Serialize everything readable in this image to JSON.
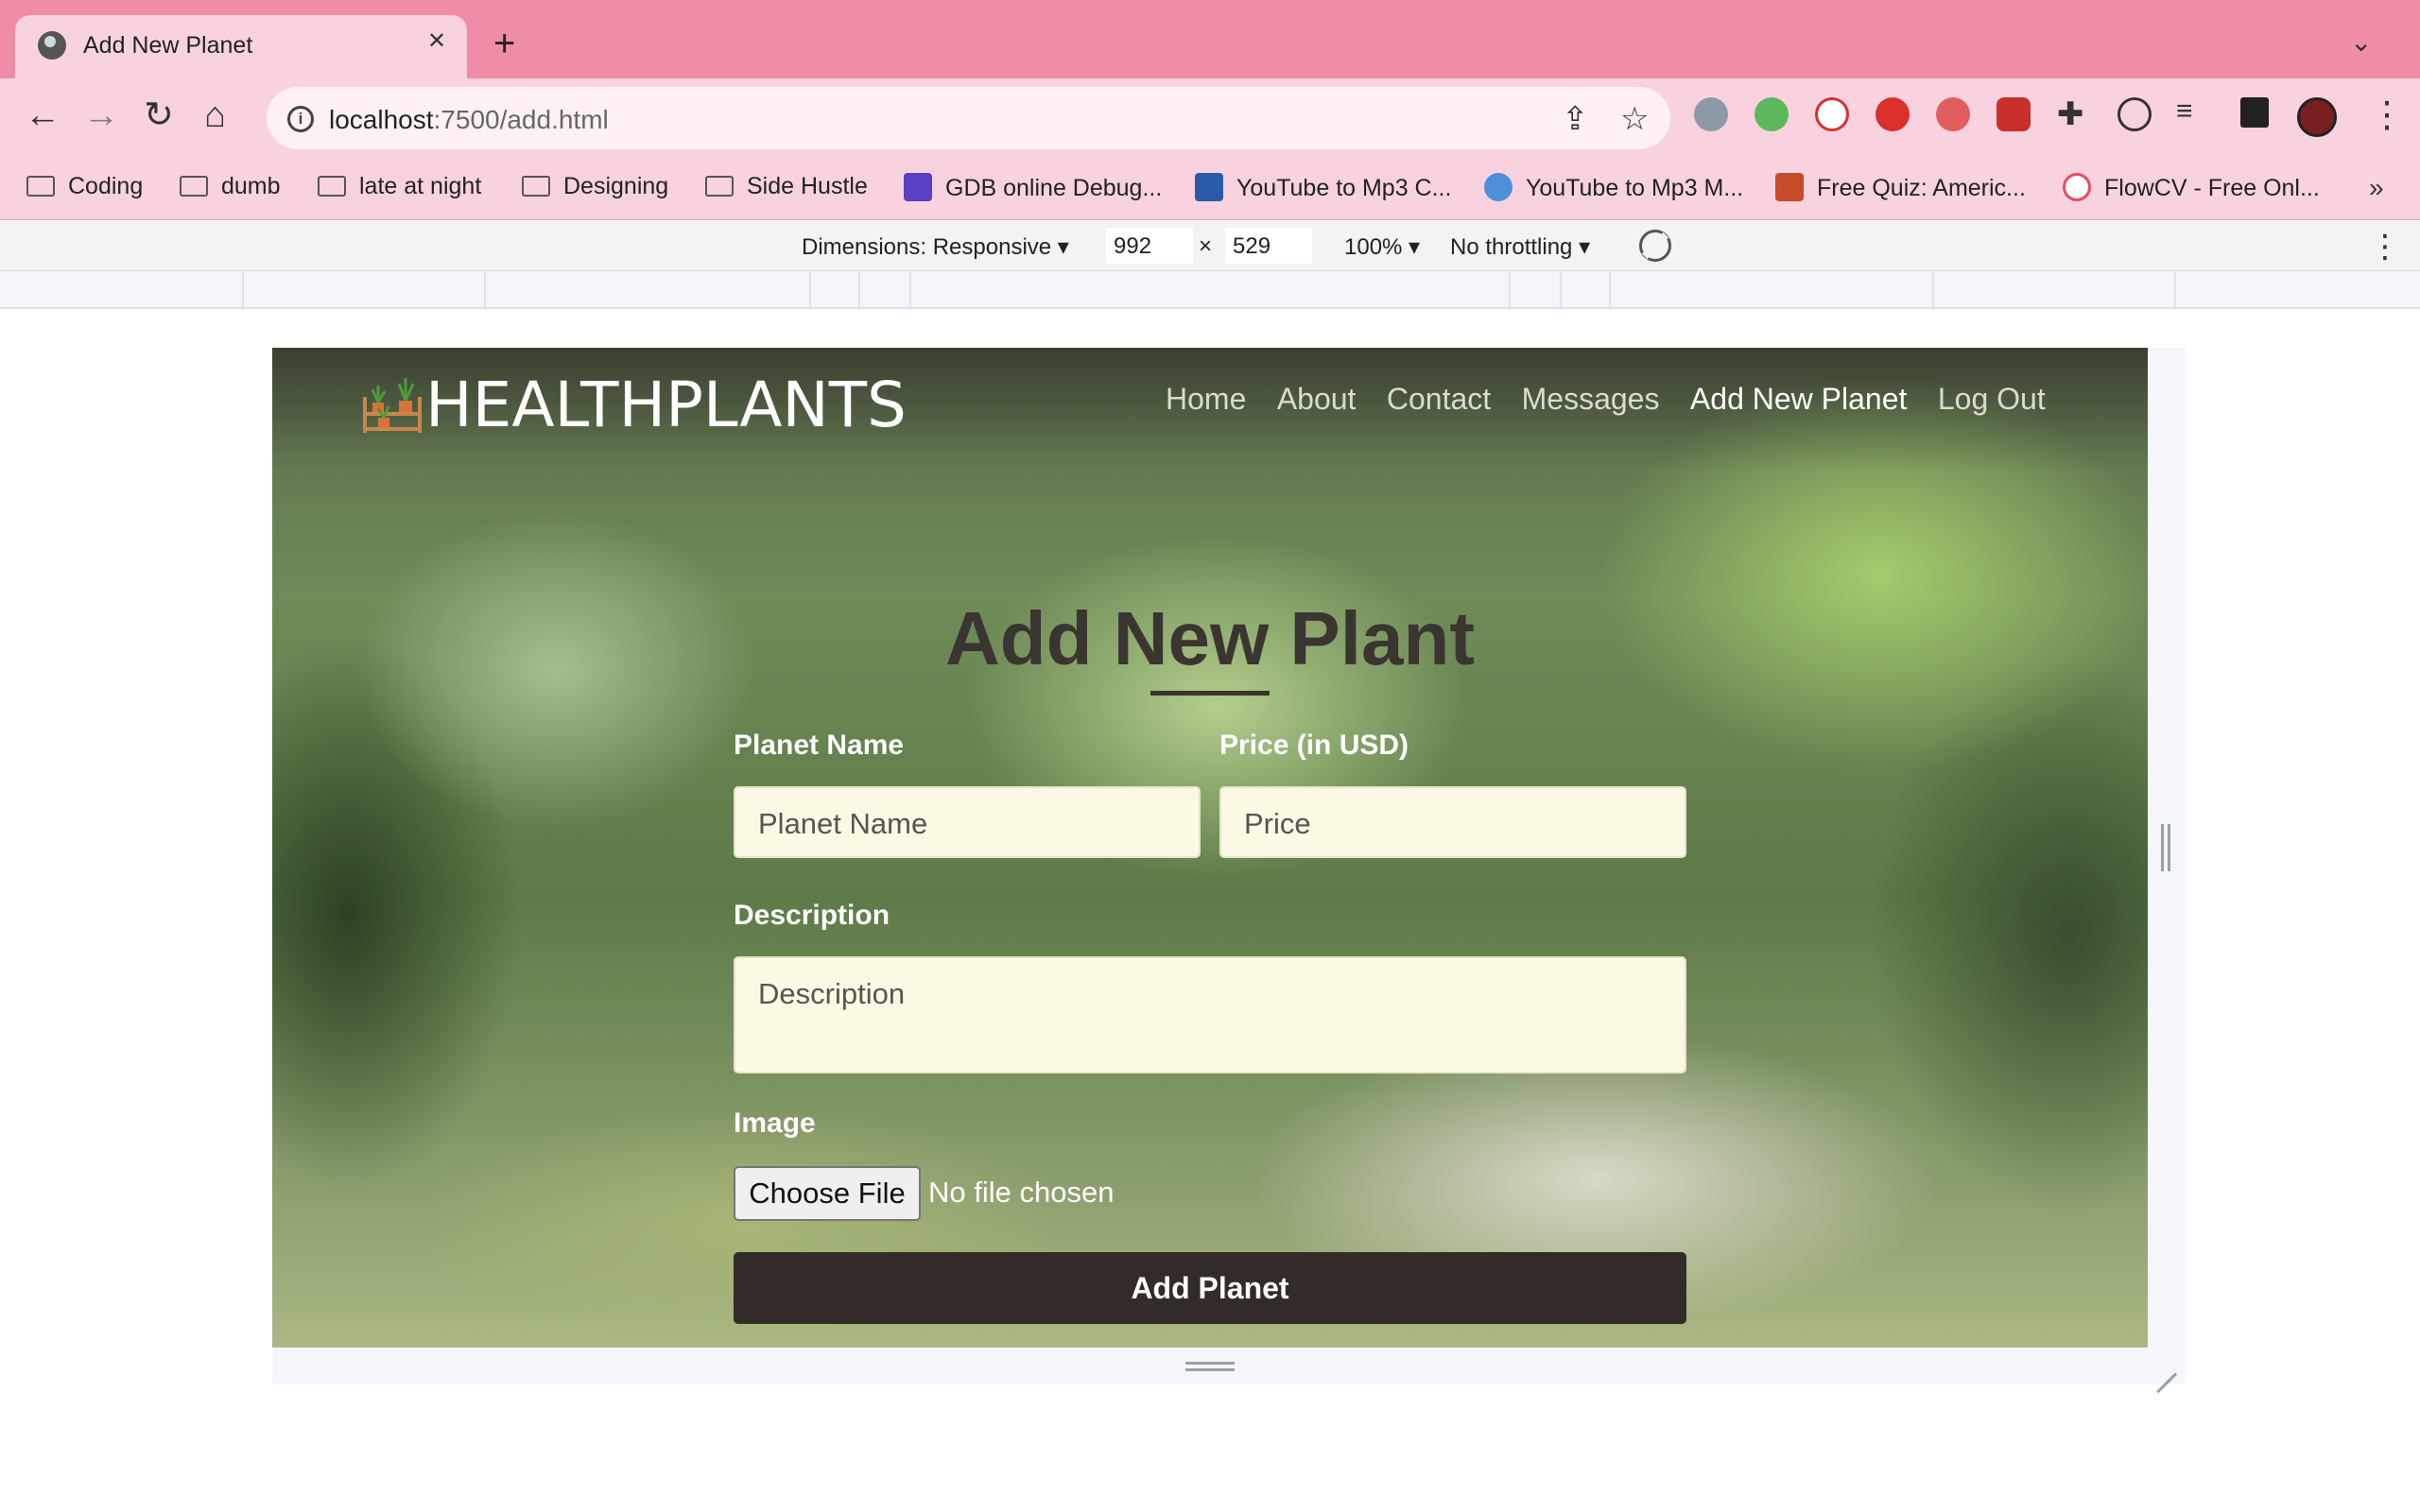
{
  "browser": {
    "tab": {
      "title": "Add New Planet",
      "close": "✕"
    },
    "new_tab": "+",
    "tab_menu": "⌄",
    "nav": {
      "back": "←",
      "forward": "→",
      "reload": "↻",
      "home": "⌂"
    },
    "url": {
      "host": "localhost",
      "path": ":7500/add.html"
    },
    "bookmarks": [
      {
        "label": "Coding",
        "icon": "folder-icon"
      },
      {
        "label": "dumb",
        "icon": "folder-icon"
      },
      {
        "label": "late at night",
        "icon": "folder-icon"
      },
      {
        "label": "Designing",
        "icon": "folder-icon"
      },
      {
        "label": "Side Hustle",
        "icon": "folder-icon"
      },
      {
        "label": "GDB online Debug...",
        "icon": "gdb-icon"
      },
      {
        "label": "YouTube to Mp3 C...",
        "icon": "download-icon"
      },
      {
        "label": "YouTube to Mp3 M...",
        "icon": "cloud-download-icon"
      },
      {
        "label": "Free Quiz: Americ...",
        "icon": "quiz-icon"
      },
      {
        "label": "FlowCV - Free Onl...",
        "icon": "flowcv-icon"
      }
    ],
    "bookmarks_more": "»"
  },
  "devtools": {
    "dimensions_label": "Dimensions: Responsive ▾",
    "width": "992",
    "times": "×",
    "height": "529",
    "zoom": "100% ▾",
    "throttling": "No throttling ▾",
    "more": "⋮"
  },
  "site": {
    "brand": "HEALTHPLANTS",
    "nav": [
      {
        "label": "Home",
        "active": false
      },
      {
        "label": "About",
        "active": false
      },
      {
        "label": "Contact",
        "active": false
      },
      {
        "label": "Messages",
        "active": false
      },
      {
        "label": "Add New Planet",
        "active": true
      },
      {
        "label": "Log Out",
        "active": false
      }
    ]
  },
  "form": {
    "heading": "Add New Plant",
    "name": {
      "label": "Planet Name",
      "placeholder": "Planet Name"
    },
    "price": {
      "label": "Price (in USD)",
      "placeholder": "Price"
    },
    "description": {
      "label": "Description",
      "placeholder": "Description"
    },
    "image": {
      "label": "Image",
      "button": "Choose File",
      "status": "No file chosen"
    },
    "submit": "Add Planet"
  },
  "colors": {
    "tabstrip": "#ef8ca6",
    "toolbar": "#f8d3df",
    "input_bg": "#fbf8e3",
    "submit_bg": "#332b28",
    "heading": "#3a3530"
  }
}
